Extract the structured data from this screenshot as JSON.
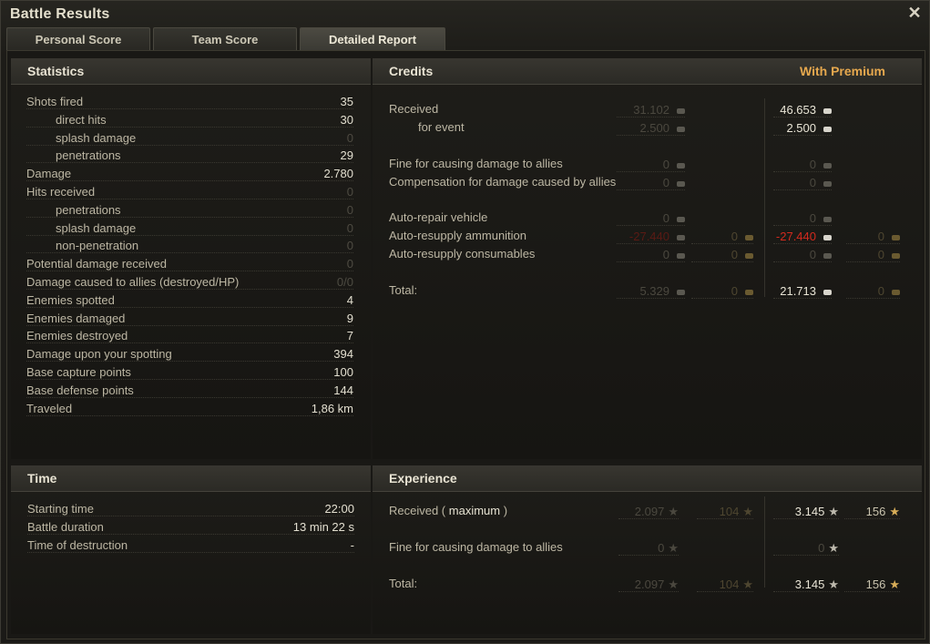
{
  "window": {
    "title": "Battle Results"
  },
  "tabs": [
    {
      "label": "Personal Score"
    },
    {
      "label": "Team Score"
    },
    {
      "label": "Detailed Report"
    }
  ],
  "statistics": {
    "title": "Statistics",
    "rows": [
      {
        "label": "Shots fired",
        "value": "35"
      },
      {
        "label": "direct hits",
        "value": "30"
      },
      {
        "label": "splash damage",
        "value": "0"
      },
      {
        "label": "penetrations",
        "value": "29"
      },
      {
        "label": "Damage",
        "value": "2.780"
      },
      {
        "label": "Hits received",
        "value": "0"
      },
      {
        "label": "penetrations",
        "value": "0"
      },
      {
        "label": "splash damage",
        "value": "0"
      },
      {
        "label": "non-penetration",
        "value": "0"
      },
      {
        "label": "Potential damage received",
        "value": "0"
      },
      {
        "label": "Damage caused to allies (destroyed/HP)",
        "value": "0/0"
      },
      {
        "label": "Enemies spotted",
        "value": "4"
      },
      {
        "label": "Enemies damaged",
        "value": "9"
      },
      {
        "label": "Enemies destroyed",
        "value": "7"
      },
      {
        "label": "Damage upon your spotting",
        "value": "394"
      },
      {
        "label": "Base capture points",
        "value": "100"
      },
      {
        "label": "Base defense points",
        "value": "144"
      },
      {
        "label": "Traveled",
        "value": "1,86 km"
      }
    ]
  },
  "credits": {
    "title": "Credits",
    "premium_label": "With Premium",
    "rows": [
      {
        "label": "Received",
        "std": "31.102",
        "prem": "46.653"
      },
      {
        "label": "for event",
        "std": "2.500",
        "prem": "2.500"
      },
      {
        "label": "Fine for causing damage to allies",
        "std": "0",
        "prem": "0"
      },
      {
        "label": "Compensation for damage caused by allies",
        "std": "0",
        "prem": "0"
      },
      {
        "label": "Auto-repair vehicle",
        "std": "0",
        "prem": "0"
      },
      {
        "label": "Auto-resupply ammunition",
        "std": "-27.440",
        "std_gold": "0",
        "prem": "-27.440",
        "prem_gold": "0"
      },
      {
        "label": "Auto-resupply consumables",
        "std": "0",
        "std_gold": "0",
        "prem": "0",
        "prem_gold": "0"
      },
      {
        "label": "Total:",
        "std": "5.329",
        "std_gold": "0",
        "prem": "21.713",
        "prem_gold": "0"
      }
    ]
  },
  "time": {
    "title": "Time",
    "rows": [
      {
        "label": "Starting time",
        "value": "22:00"
      },
      {
        "label": "Battle duration",
        "value": "13 min 22 s"
      },
      {
        "label": "Time of destruction",
        "value": "-"
      }
    ]
  },
  "experience": {
    "title": "Experience",
    "received_label": "Received (",
    "received_max": "maximum",
    "received_close": ")",
    "rows": [
      {
        "label": "Received",
        "std_xp": "2.097",
        "std_free": "104",
        "prem_xp": "3.145",
        "prem_free": "156"
      },
      {
        "label": "Fine for causing damage to allies",
        "std_xp": "0",
        "prem_xp": "0"
      },
      {
        "label": "Total:",
        "std_xp": "2.097",
        "std_free": "104",
        "prem_xp": "3.145",
        "prem_free": "156"
      }
    ]
  },
  "icons": {
    "close": "close-icon",
    "credit": "credit-coin-icon",
    "gold": "gold-coin-icon",
    "xp": "xp-star-icon",
    "free_xp": "free-xp-star-icon"
  },
  "colors": {
    "accent_premium": "#e6a84e",
    "negative": "#d22a1e"
  }
}
